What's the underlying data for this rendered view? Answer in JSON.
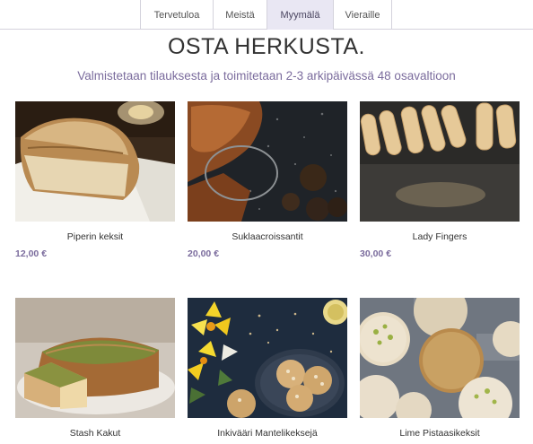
{
  "nav": {
    "tabs": [
      {
        "label": "Tervetuloa",
        "active": false
      },
      {
        "label": "Meistä",
        "active": false
      },
      {
        "label": "Myymälä",
        "active": true
      },
      {
        "label": "Vieraille",
        "active": false
      }
    ]
  },
  "header": {
    "title": "OSTA HERKUSTA.",
    "subtitle": "Valmistetaan tilauksesta ja toimitetaan 2-3 arkipäivässä 48 osavaltioon"
  },
  "products": [
    {
      "name": "Piperin keksit",
      "price": "12,00 €"
    },
    {
      "name": "Suklaacroissantit",
      "price": "20,00 €"
    },
    {
      "name": "Lady Fingers",
      "price": "30,00 €"
    },
    {
      "name": "Stash Kakut",
      "price": ""
    },
    {
      "name": "Inkivääri Mantelikeksejä",
      "price": ""
    },
    {
      "name": "Lime Pistaasikeksit",
      "price": ""
    }
  ],
  "colors": {
    "accent": "#7b6c9d",
    "active_tab_bg": "#e9e7f3",
    "border": "#d4d2dc"
  }
}
